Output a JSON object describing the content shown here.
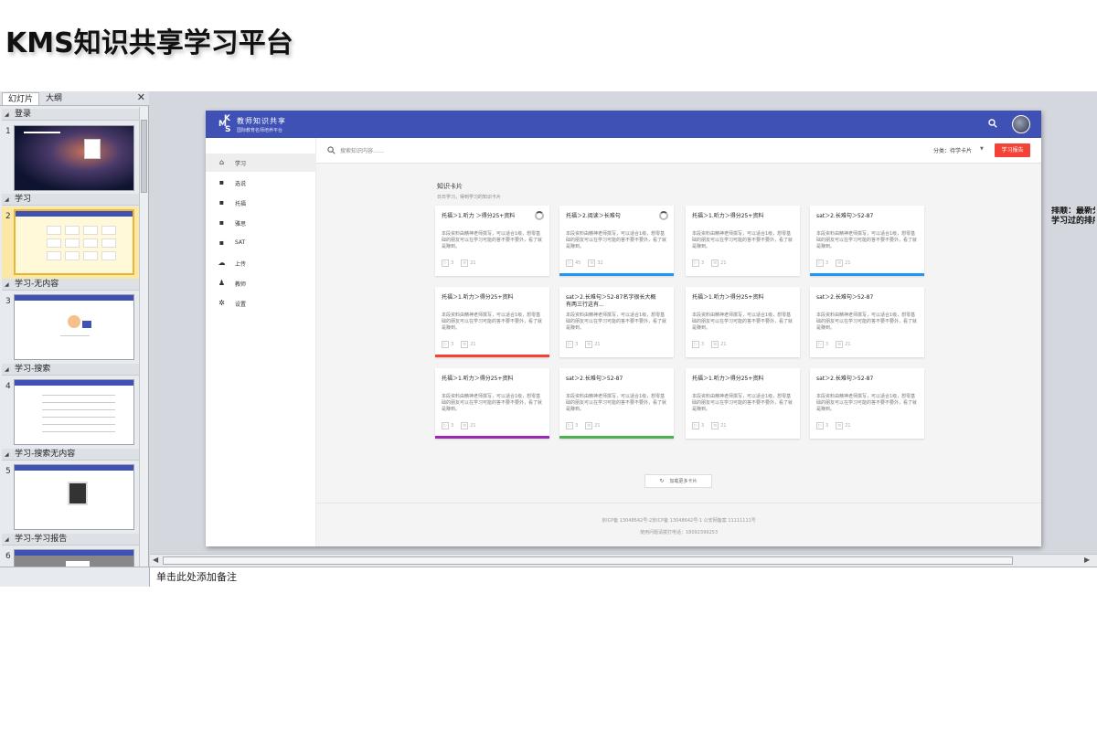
{
  "page_title": "KMS知识共享学习平台",
  "left_pane": {
    "tabs": [
      "幻灯片",
      "大纲"
    ],
    "close_label": "✕",
    "sections": [
      {
        "label": "登录",
        "slide": "1"
      },
      {
        "label": "学习",
        "slide": "2"
      },
      {
        "label": "学习-无内容",
        "slide": "3"
      },
      {
        "label": "学习-搜索",
        "slide": "4"
      },
      {
        "label": "学习-搜索无内容",
        "slide": "5"
      },
      {
        "label": "学习-学习报告",
        "slide": "6"
      }
    ]
  },
  "notes_placeholder": "单击此处添加备注",
  "side_note": "排顺：最新分享\n学习过的排序",
  "slide": {
    "app_title": "教师知识共享",
    "app_subtitle": "国际教育名师培养平台",
    "nav": [
      {
        "label": "学习",
        "icon": "⌂"
      },
      {
        "label": "选说",
        "icon": "▪"
      },
      {
        "label": "托福",
        "icon": "▪"
      },
      {
        "label": "雅思",
        "icon": "▪"
      },
      {
        "label": "SAT",
        "icon": "▪"
      },
      {
        "label": "上传",
        "icon": "☁"
      },
      {
        "label": "教师",
        "icon": "♟"
      },
      {
        "label": "设置",
        "icon": "✲"
      }
    ],
    "search_placeholder": "搜索知识内容……",
    "sort_label": "分类：待学卡片",
    "report_button": "学习报告",
    "section_title": "知识卡片",
    "section_subtitle": "日日学习，得到学习的知识卡片",
    "desc_text": "本段资料由精神老师撰写，可以适合1级，想零基础的朋友可以在学习可能的答不要不要外，看了就是赚到。",
    "cards": [
      {
        "title": "托福＞1.听力 ＞得分25+资料",
        "plays": "3",
        "docs": "21",
        "bar": "",
        "progress": true
      },
      {
        "title": "托福＞2.阅读＞长难句",
        "plays": "45",
        "docs": "32",
        "bar": "#2196f3",
        "progress": true
      },
      {
        "title": "托福＞1.听力＞得分25+资料",
        "plays": "3",
        "docs": "21",
        "bar": "",
        "progress": false
      },
      {
        "title": "sat＞2.长难句＞52-87",
        "plays": "3",
        "docs": "21",
        "bar": "#2196f3",
        "progress": false
      },
      {
        "title": "托福＞1.听力＞得分25+资料",
        "plays": "3",
        "docs": "21",
        "bar": "#f44336",
        "progress": false
      },
      {
        "title": "sat＞2.长难句＞52-87名字很长大概有两三行这有...",
        "plays": "3",
        "docs": "21",
        "bar": "",
        "progress": false
      },
      {
        "title": "托福＞1.听力＞得分25+资料",
        "plays": "3",
        "docs": "21",
        "bar": "",
        "progress": false
      },
      {
        "title": "sat＞2.长难句＞52-87",
        "plays": "3",
        "docs": "21",
        "bar": "",
        "progress": false
      },
      {
        "title": "托福＞1.听力＞得分25+资料",
        "plays": "3",
        "docs": "21",
        "bar": "#9c27b0",
        "progress": false
      },
      {
        "title": "sat＞2.长难句＞52-87",
        "plays": "3",
        "docs": "21",
        "bar": "#4caf50",
        "progress": false
      },
      {
        "title": "托福＞1.听力＞得分25+资料",
        "plays": "3",
        "docs": "21",
        "bar": "",
        "progress": false
      },
      {
        "title": "sat＞2.长难句＞52-87",
        "plays": "3",
        "docs": "21",
        "bar": "",
        "progress": false
      }
    ],
    "load_more": "加载更多卡片",
    "footer_line1": "京ICP备 13048642号-2京ICP备 13048642号-1 公安网备案 11111111号",
    "footer_line2": "使用问题请拨打电话：18092399253"
  },
  "colors": {
    "header": "#3f51b5",
    "report_button": "#f44336"
  }
}
